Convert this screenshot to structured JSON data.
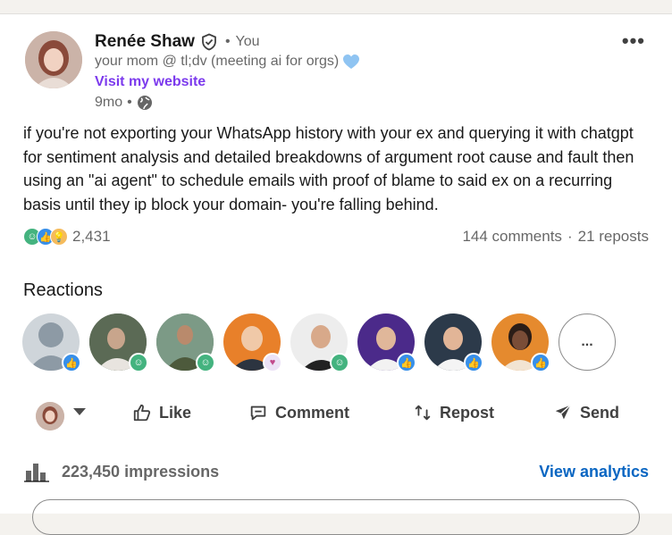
{
  "author": {
    "name": "Renée Shaw",
    "relation": "You",
    "headline": "your mom @ tl;dv (meeting ai for orgs)",
    "website_label": "Visit my website",
    "time_ago": "9mo"
  },
  "post": {
    "text": "if you're not exporting your WhatsApp history with your ex and querying it with chatgpt for sentiment analysis and detailed breakdowns of argument root cause and fault then using an \"ai agent\" to schedule emails with proof of blame to said ex on a recurring basis until they ip block your domain- you're falling behind."
  },
  "counts": {
    "reactions": "2,431",
    "comments": "144 comments",
    "reposts": "21 reposts"
  },
  "reactions_section": {
    "title": "Reactions",
    "more_label": "..."
  },
  "actions": {
    "like": "Like",
    "comment": "Comment",
    "repost": "Repost",
    "send": "Send"
  },
  "analytics": {
    "impressions": "223,450 impressions",
    "view_label": "View analytics"
  },
  "colors": {
    "link_purple": "#7c3aed",
    "brand_blue": "#0a66c2",
    "like_blue": "#378fe9",
    "funny_teal": "#44b37f"
  }
}
